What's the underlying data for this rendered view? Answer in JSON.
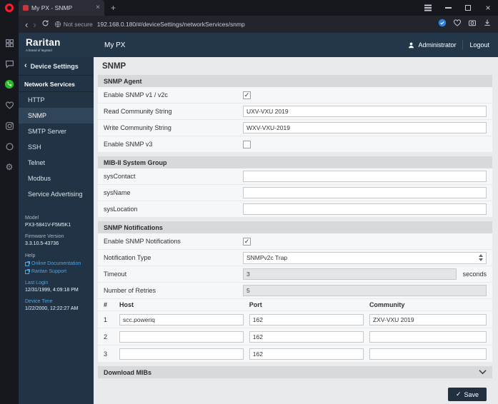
{
  "colors": {
    "accent_navy": "#24364a",
    "sidebar_active": "#31455a",
    "link_blue": "#4da3e0",
    "opera_red": "#ff1b2d",
    "whatsapp_green": "#2bb826",
    "badge_blue": "#2e7fe0",
    "section_header_gray": "#d7d9db",
    "content_bg": "#e8eaec"
  },
  "glyphs": {
    "back": "‹",
    "forward": "›",
    "plus": "+",
    "close": "×",
    "check": "✓",
    "gear": "⚙"
  },
  "browser": {
    "tab_title": "My PX - SNMP",
    "security_label": "Not secure",
    "url": "192.168.0.180/#/deviceSettings/networkServices/snmp"
  },
  "app_header": {
    "logo": "Raritan",
    "logo_tagline": "A brand of legrand",
    "product": "My PX",
    "user": "Administrator",
    "logout": "Logout"
  },
  "sidebar": {
    "back_label": "Device Settings",
    "section_label": "Network Services",
    "items": [
      {
        "label": "HTTP"
      },
      {
        "label": "SNMP"
      },
      {
        "label": "SMTP Server"
      },
      {
        "label": "SSH"
      },
      {
        "label": "Telnet"
      },
      {
        "label": "Modbus"
      },
      {
        "label": "Service Advertising"
      }
    ],
    "info": {
      "model_label": "Model",
      "model_value": "PX3-5841V-F5M5K1",
      "firmware_label": "Firmware Version",
      "firmware_value": "3.3.10.5-43736",
      "help_label": "Help",
      "link_docs": "Online Documentation",
      "link_support": "Raritan Support",
      "last_login_label": "Last Login",
      "last_login_value": "12/31/1999, 4:09:18 PM",
      "device_time_label": "Device Time",
      "device_time_value": "1/22/2000, 12:22:27 AM"
    }
  },
  "main": {
    "page_title": "SNMP",
    "agent": {
      "title": "SNMP Agent",
      "enable_v1v2_label": "Enable SNMP v1 / v2c",
      "enable_v1v2_checked": true,
      "read_label": "Read Community String",
      "read_value": "UXV-VXU 2019",
      "write_label": "Write Community String",
      "write_value": "WXV-VXU-2019",
      "enable_v3_label": "Enable SNMP v3",
      "enable_v3_checked": false
    },
    "mib": {
      "title": "MIB-II System Group",
      "syscontact_label": "sysContact",
      "syscontact_value": "",
      "sysname_label": "sysName",
      "sysname_value": "",
      "syslocation_label": "sysLocation",
      "syslocation_value": ""
    },
    "notifications": {
      "title": "SNMP Notifications",
      "enable_label": "Enable SNMP Notifications",
      "enable_checked": true,
      "type_label": "Notification Type",
      "type_value": "SNMPv2c Trap",
      "timeout_label": "Timeout",
      "timeout_value": "3",
      "timeout_unit": "seconds",
      "retries_label": "Number of Retries",
      "retries_value": "5",
      "table_headers": {
        "num": "#",
        "host": "Host",
        "port": "Port",
        "community": "Community"
      },
      "table_rows": [
        {
          "num": "1",
          "host": "scc.poweriq",
          "port": "162",
          "community": "ZXV-VXU 2019"
        },
        {
          "num": "2",
          "host": "",
          "port": "162",
          "community": ""
        },
        {
          "num": "3",
          "host": "",
          "port": "162",
          "community": ""
        }
      ]
    },
    "download": {
      "title": "Download MIBs"
    },
    "save_label": "Save"
  }
}
